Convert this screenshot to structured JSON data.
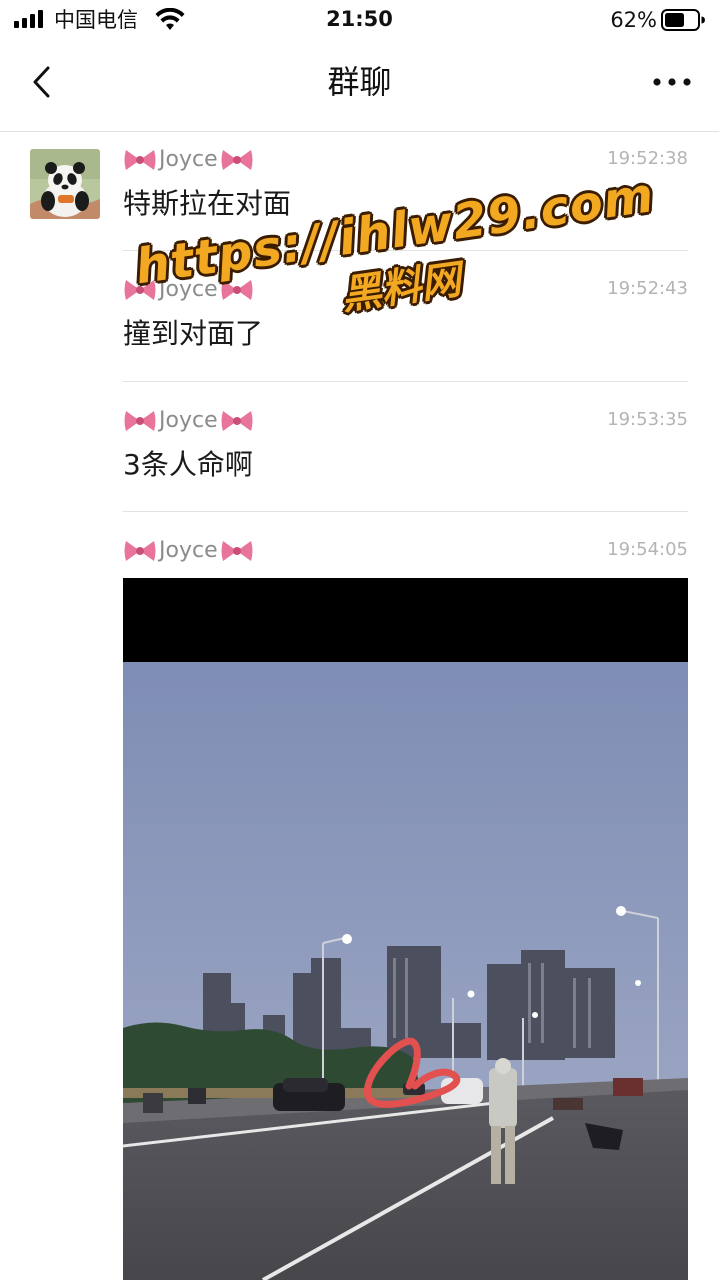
{
  "status_bar": {
    "carrier": "中国电信",
    "time": "21:50",
    "battery_percent": "62%",
    "battery_level": 0.62
  },
  "nav": {
    "title": "群聊",
    "back_icon": "chevron-left-icon",
    "more_icon": "more-dots-icon"
  },
  "messages": [
    {
      "sender": "Joyce",
      "time": "19:52:38",
      "text": "特斯拉在对面"
    },
    {
      "sender": "Joyce",
      "time": "19:52:43",
      "text": "撞到对面了"
    },
    {
      "sender": "Joyce",
      "time": "19:53:35",
      "text": "3条人命啊"
    },
    {
      "sender": "Joyce",
      "time": "19:54:05",
      "text": ""
    }
  ],
  "watermark": {
    "url": "https://ihlw29.com",
    "name": "黑料网"
  },
  "colors": {
    "accent_watermark": "#f3a821",
    "bow_pink": "#e8749a",
    "sender_gray": "#8b8b8b",
    "time_gray": "#b4b4b4"
  }
}
